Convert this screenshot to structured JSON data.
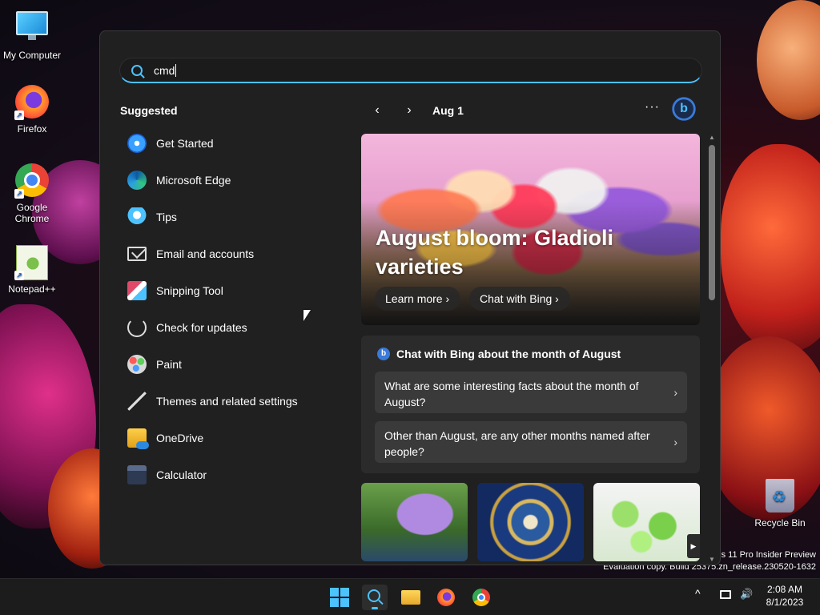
{
  "desktop": {
    "icons": [
      {
        "label": "My Computer"
      },
      {
        "label": "Firefox"
      },
      {
        "label": "Google Chrome"
      },
      {
        "label": "Notepad++"
      },
      {
        "label": "Recycle Bin"
      }
    ],
    "watermark": {
      "line1": "s 11 Pro Insider Preview",
      "line2": "Evaluation copy. Build 25375.zn_release.230520-1632"
    }
  },
  "search": {
    "value": "cmd",
    "accent": "#4cc2ff"
  },
  "suggested": {
    "title": "Suggested",
    "items": [
      {
        "label": "Get Started",
        "icon": "get-started-icon"
      },
      {
        "label": "Microsoft Edge",
        "icon": "edge-icon"
      },
      {
        "label": "Tips",
        "icon": "tips-icon"
      },
      {
        "label": "Email and accounts",
        "icon": "mail-icon"
      },
      {
        "label": "Snipping Tool",
        "icon": "snipping-tool-icon"
      },
      {
        "label": "Check for updates",
        "icon": "refresh-icon"
      },
      {
        "label": "Paint",
        "icon": "paint-icon"
      },
      {
        "label": "Themes and related settings",
        "icon": "brush-icon"
      },
      {
        "label": "OneDrive",
        "icon": "onedrive-icon"
      },
      {
        "label": "Calculator",
        "icon": "calculator-icon"
      }
    ]
  },
  "highlights": {
    "prev": "‹",
    "next": "›",
    "date": "Aug 1",
    "more": "···",
    "bing_glyph": "b",
    "hero": {
      "title": "August bloom: Gladioli varieties",
      "learn_more": "Learn more",
      "chat_with_bing": "Chat with Bing",
      "chevron": "›"
    },
    "bing_card": {
      "title": "Chat with Bing about the month of August",
      "questions": [
        "What are some interesting facts about the month of August?",
        "Other than August, are any other months named after people?"
      ],
      "chevron": "›"
    }
  },
  "taskbar": {
    "clock_time": "2:08 AM",
    "clock_date": "8/1/2023",
    "tray_up": "^",
    "volume": "🔊"
  }
}
